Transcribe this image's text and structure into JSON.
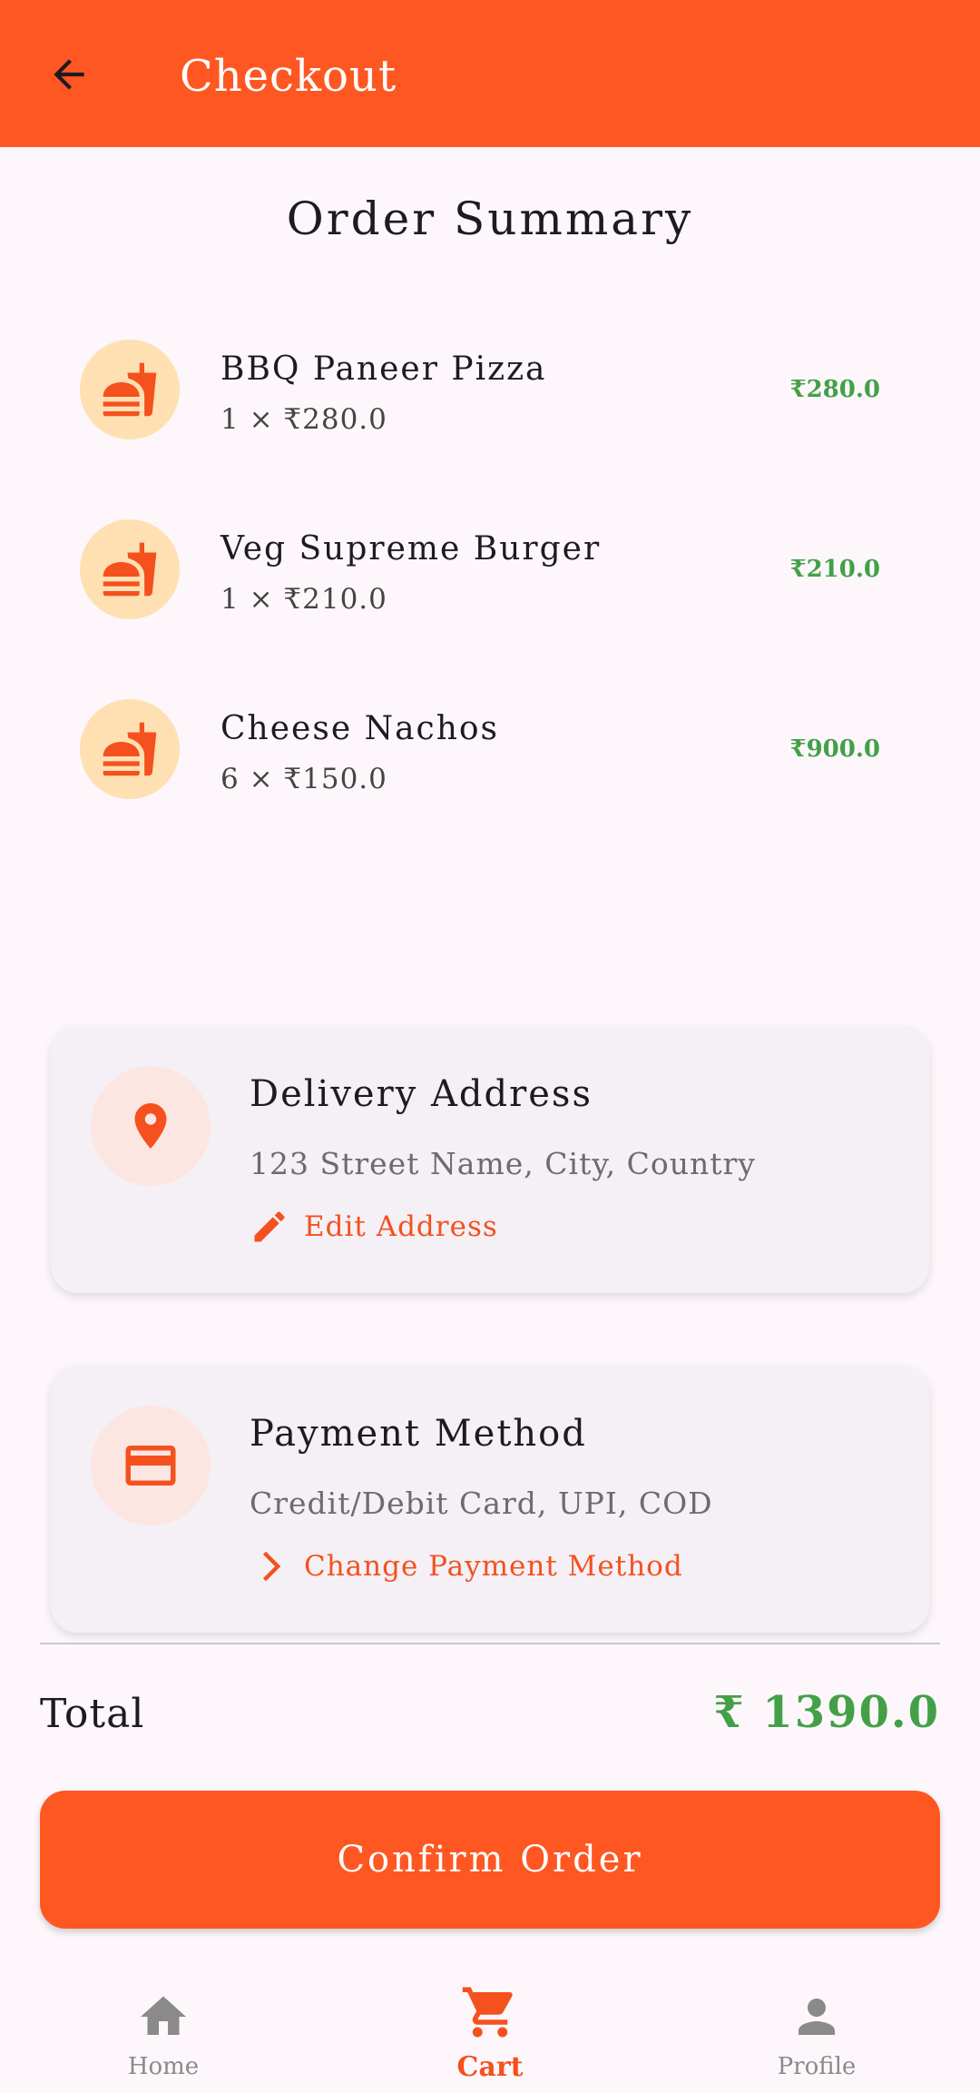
{
  "appbar": {
    "title": "Checkout",
    "back_icon": "arrow-back-icon"
  },
  "summary": {
    "title": "Order Summary",
    "items": [
      {
        "name": "BBQ Paneer Pizza",
        "qty": "1 × ₹280.0",
        "price": "₹280.0",
        "icon": "fastfood-icon"
      },
      {
        "name": "Veg Supreme Burger",
        "qty": "1 × ₹210.0",
        "price": "₹210.0",
        "icon": "fastfood-icon"
      },
      {
        "name": "Cheese Nachos",
        "qty": "6 × ₹150.0",
        "price": "₹900.0",
        "icon": "fastfood-icon"
      }
    ]
  },
  "delivery": {
    "title": "Delivery Address",
    "address": "123 Street Name, City, Country",
    "action": "Edit Address",
    "icon": "location-pin-icon",
    "action_icon": "edit-pencil-icon"
  },
  "payment": {
    "title": "Payment Method",
    "methods": "Credit/Debit Card, UPI, COD",
    "action": "Change Payment Method",
    "icon": "credit-card-icon",
    "action_icon": "chevron-right-icon"
  },
  "total": {
    "label": "Total",
    "value": "₹ 1390.0"
  },
  "confirm_label": "Confirm Order",
  "nav": {
    "home": "Home",
    "cart": "Cart",
    "profile": "Profile",
    "active": "cart"
  },
  "colors": {
    "primary": "#ff5722",
    "price_green": "#43a047",
    "avatar_bg": "#ffe0b2",
    "card_bg": "#f4f0f6"
  }
}
